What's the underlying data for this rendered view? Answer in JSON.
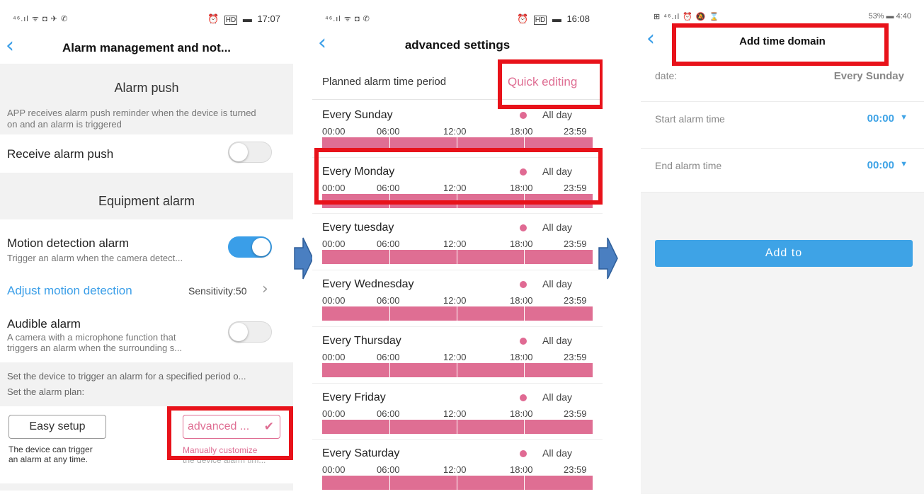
{
  "screen1": {
    "status": {
      "left": "⁴⁶.ıl ᯤ ◘ ✈ ✆",
      "alarm": "⏰",
      "hd": "HD",
      "battery": "▬",
      "time": "17:07"
    },
    "title": "Alarm management and not...",
    "alarm_push_header": "Alarm push",
    "alarm_push_desc_line1": "APP receives alarm push reminder when the device is turned",
    "alarm_push_desc_line2": "on and an alarm is triggered",
    "receive_push_label": "Receive alarm push",
    "receive_push_on": false,
    "equipment_header": "Equipment alarm",
    "motion_label": "Motion detection alarm",
    "motion_desc": "Trigger an alarm when the camera detect...",
    "motion_on": true,
    "adjust_label": "Adjust motion detection",
    "sensitivity": "Sensitivity:50",
    "audible_label": "Audible alarm",
    "audible_desc_line1": "A camera with a microphone function that",
    "audible_desc_line2": "triggers an alarm when the surrounding s...",
    "audible_on": false,
    "period_line1": "Set the device to trigger an alarm for a specified period o...",
    "period_line2": "Set the alarm plan:",
    "easy_setup_label": "Easy setup",
    "easy_desc_line1": "The device can trigger",
    "easy_desc_line2": "an alarm at any time.",
    "advanced_label": "advanced ...",
    "advanced_desc_line1": "Manually customize",
    "advanced_desc_line2": "the device alarm tim..."
  },
  "screen2": {
    "status": {
      "left": "⁴⁶.ıl ᯤ ◘ ✆",
      "alarm": "⏰",
      "hd": "HD",
      "battery": "▬",
      "time": "16:08"
    },
    "title": "advanced settings",
    "planned_label": "Planned alarm time period",
    "quick_edit": "Quick editing",
    "allday": "All day",
    "ticks": [
      "00:00",
      "06:00",
      "12:00",
      "18:00",
      "23:59"
    ],
    "days": [
      "Every Sunday",
      "Every Monday",
      "Every tuesday",
      "Every Wednesday",
      "Every Thursday",
      "Every Friday",
      "Every Saturday"
    ]
  },
  "screen3": {
    "status": {
      "left": "⊞ ⁴⁶.ıl ⏰ 🔕 ⌛",
      "battery": "53% ▬ 4:40"
    },
    "title": "Add time domain",
    "date_label": "date:",
    "date_value": "Every Sunday",
    "start_label": "Start alarm time",
    "start_value": "00:00",
    "end_label": "End alarm time",
    "end_value": "00:00",
    "add_button": "Add to"
  },
  "colors": {
    "accent_blue": "#3a9ee8",
    "pink": "#df6e93",
    "highlight_red": "#e8121a",
    "flow_arrow": "#4a7fc1"
  },
  "icons": [
    "back-chevron-icon",
    "chevron-right-icon",
    "checkmark-icon",
    "dropdown-triangle-icon",
    "flow-arrow-icon"
  ]
}
